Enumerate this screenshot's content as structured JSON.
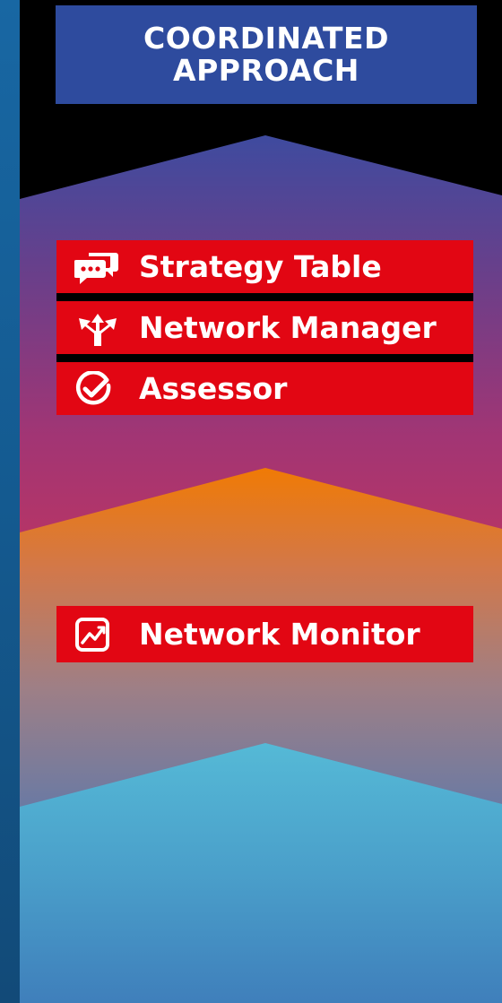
{
  "header": {
    "title_line1": "COORDINATED",
    "title_line2": "APPROACH"
  },
  "tiers": {
    "top_items": [
      {
        "label": "Strategy Table",
        "icon": "chat-bubbles-icon"
      },
      {
        "label": "Network Manager",
        "icon": "split-arrows-icon"
      },
      {
        "label": "Assessor",
        "icon": "check-circle-icon"
      }
    ],
    "middle_items": [
      {
        "label": "Network Monitor",
        "icon": "line-chart-icon"
      }
    ]
  },
  "colors": {
    "title_bg": "#2e4b9e",
    "item_bg": "#e20613",
    "band_top": "#3f4a9c",
    "band_mid_top": "#e8760c",
    "band_low_top": "#4fb4d2"
  }
}
